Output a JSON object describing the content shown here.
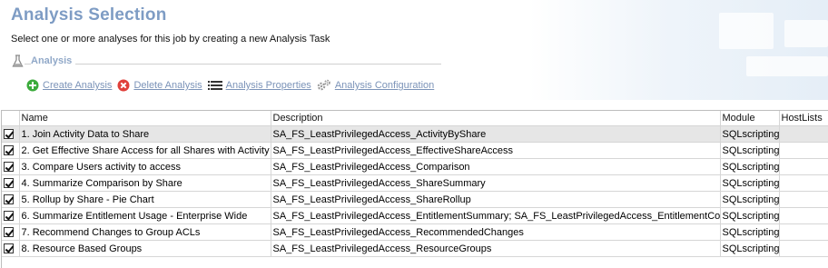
{
  "page": {
    "title": "Analysis Selection",
    "subtitle": "Select one or more analyses for this job by creating a new Analysis Task"
  },
  "section": {
    "title": "Analysis",
    "icon": "flask-icon"
  },
  "toolbar": {
    "create_label": "Create Analysis",
    "delete_label": "Delete Analysis",
    "properties_label": "Analysis Properties",
    "configuration_label": "Analysis Configuration"
  },
  "grid": {
    "columns": {
      "name": "Name",
      "description": "Description",
      "module": "Module",
      "hostlists": "HostLists"
    },
    "rows": [
      {
        "checked": true,
        "name": "1. Join Activity Data to Share",
        "description": "SA_FS_LeastPrivilegedAccess_ActivityByShare",
        "module": "SQLscripting",
        "hostlists": "",
        "selected": true
      },
      {
        "checked": true,
        "name": "2. Get Effective Share Access for all Shares with Activity",
        "description": "SA_FS_LeastPrivilegedAccess_EffectiveShareAccess",
        "module": "SQLscripting",
        "hostlists": ""
      },
      {
        "checked": true,
        "name": "3. Compare Users activity to access",
        "description": "SA_FS_LeastPrivilegedAccess_Comparison",
        "module": "SQLscripting",
        "hostlists": ""
      },
      {
        "checked": true,
        "name": "4. Summarize Comparison by Share",
        "description": "SA_FS_LeastPrivilegedAccess_ShareSummary",
        "module": "SQLscripting",
        "hostlists": ""
      },
      {
        "checked": true,
        "name": "5. Rollup by Share - Pie Chart",
        "description": "SA_FS_LeastPrivilegedAccess_ShareRollup",
        "module": "SQLscripting",
        "hostlists": ""
      },
      {
        "checked": true,
        "name": "6. Summarize Entitlement Usage - Enterprise Wide",
        "description": "SA_FS_LeastPrivilegedAccess_EntitlementSummary; SA_FS_LeastPrivilegedAccess_EntitlementCounts",
        "module": "SQLscripting",
        "hostlists": ""
      },
      {
        "checked": true,
        "name": "7. Recommend Changes to Group ACLs",
        "description": "SA_FS_LeastPrivilegedAccess_RecommendedChanges",
        "module": "SQLscripting",
        "hostlists": ""
      },
      {
        "checked": true,
        "name": "8. Resource Based Groups",
        "description": "SA_FS_LeastPrivilegedAccess_ResourceGroups",
        "module": "SQLscripting",
        "hostlists": ""
      }
    ]
  },
  "colors": {
    "title": "#7e9cc4",
    "section_title": "#90a8c8",
    "link": "#7b93b8",
    "create_icon": "#3cab3c",
    "delete_icon": "#e0403a",
    "selected_row": "#e6e6e6"
  }
}
